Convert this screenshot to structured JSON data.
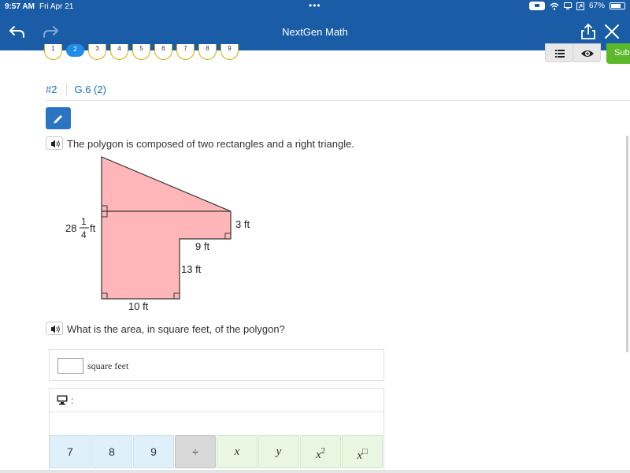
{
  "status": {
    "time": "9:57 AM",
    "date": "Fri Apr 21",
    "battery": "67%"
  },
  "app": {
    "title": "NextGen Math"
  },
  "questions": [
    "1",
    "2",
    "3",
    "4",
    "5",
    "6",
    "7",
    "8",
    "9"
  ],
  "active_question": "2",
  "submit_label": "Sub",
  "breadcrumb": {
    "number": "#2",
    "standard": "G.6 (2)"
  },
  "prompt": {
    "intro": "The polygon is composed of two rectangles and a right triangle.",
    "question": "What is the area, in square feet, of the polygon?"
  },
  "figure": {
    "left_label_whole": "28",
    "left_label_num": "1",
    "left_label_den": "4",
    "left_label_unit": "ft",
    "label_3ft": "3 ft",
    "label_9ft": "9 ft",
    "label_13ft": "13 ft",
    "label_10ft": "10 ft",
    "fill_color": "#ffb6b9"
  },
  "answer": {
    "value": "",
    "unit": "square feet"
  },
  "keypad": {
    "header_colon": ":",
    "keys": [
      "7",
      "8",
      "9",
      "÷",
      "x",
      "y",
      "x2",
      "x□"
    ]
  },
  "colors": {
    "brand": "#1a5da6",
    "accent": "#1f8ce6",
    "submit": "#5ab82a"
  }
}
